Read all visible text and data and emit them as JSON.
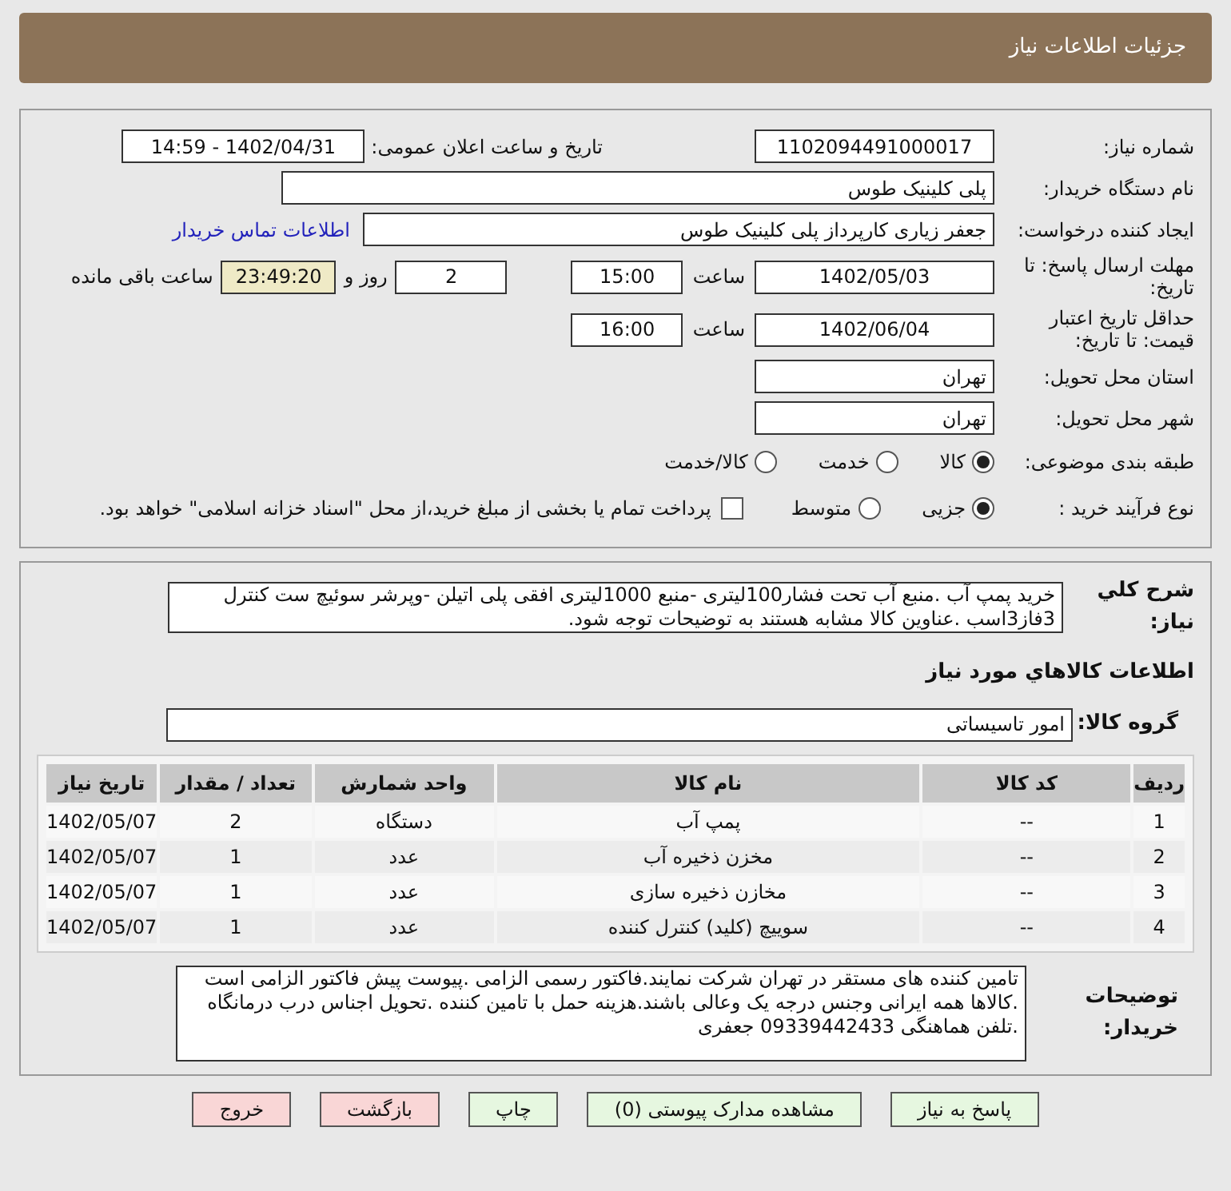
{
  "header": {
    "title": "جزئیات اطلاعات نیاز"
  },
  "need_number": {
    "label": "شماره نیاز:",
    "value": "1102094491000017"
  },
  "announce": {
    "label": "تاریخ و ساعت اعلان عمومی:",
    "value": "1402/04/31 - 14:59"
  },
  "buyer_org": {
    "label": "نام دستگاه خریدار:",
    "value": "پلی کلینیک طوس"
  },
  "requester": {
    "label": "ایجاد کننده درخواست:",
    "value": "جعفر زیاری کارپرداز پلی کلینیک طوس",
    "link": "اطلاعات تماس خریدار"
  },
  "deadline": {
    "label": "مهلت ارسال پاسخ: تا تاریخ:",
    "date": "1402/05/03",
    "time_label": "ساعت",
    "time": "15:00",
    "days": "2",
    "days_label": "روز و",
    "remaining": "23:49:20",
    "remaining_label": "ساعت باقی مانده"
  },
  "validity": {
    "label": "حداقل تاریخ اعتبار قیمت: تا تاریخ:",
    "date": "1402/06/04",
    "time_label": "ساعت",
    "time": "16:00"
  },
  "province": {
    "label": "استان محل تحویل:",
    "value": "تهران"
  },
  "city": {
    "label": "شهر محل تحویل:",
    "value": "تهران"
  },
  "category": {
    "label": "طبقه بندی موضوعی:",
    "options": [
      {
        "label": "کالا",
        "selected": true
      },
      {
        "label": "خدمت",
        "selected": false
      },
      {
        "label": "کالا/خدمت",
        "selected": false
      }
    ]
  },
  "process": {
    "label": "نوع فرآیند خرید :",
    "options": [
      {
        "label": "جزیی",
        "selected": true
      },
      {
        "label": "متوسط",
        "selected": false
      }
    ],
    "payment": {
      "checked": false,
      "label": "پرداخت تمام یا بخشی از مبلغ خرید،از محل \"اسناد خزانه اسلامی\" خواهد بود."
    }
  },
  "description": {
    "label": "شرح کلي نیاز:",
    "value": "خرید پمپ آب .منبع آب تحت فشار100لیتری -منبع 1000لیتری افقی پلی اتیلن -وپرشر سوئیچ ست کنترل 3فاز3اسب .عناوین کالا مشابه هستند به توضیحات توجه شود."
  },
  "goods_heading": "اطلاعات کالاهاي مورد نیاز",
  "goods_group": {
    "label": "گروه کالا:",
    "value": "امور تاسیساتی"
  },
  "table": {
    "columns": [
      "ردیف",
      "کد کالا",
      "نام کالا",
      "واحد شمارش",
      "تعداد / مقدار",
      "تاریخ نیاز"
    ],
    "rows": [
      [
        "1",
        "--",
        "پمپ آب",
        "دستگاه",
        "2",
        "1402/05/07"
      ],
      [
        "2",
        "--",
        "مخزن ذخیره آب",
        "عدد",
        "1",
        "1402/05/07"
      ],
      [
        "3",
        "--",
        "مخازن ذخیره سازی",
        "عدد",
        "1",
        "1402/05/07"
      ],
      [
        "4",
        "--",
        "سوییچ (کلید) کنترل کننده",
        "عدد",
        "1",
        "1402/05/07"
      ]
    ]
  },
  "buyer_notes": {
    "label": "توضیحات خریدار:",
    "value": "تامین کننده های مستقر در تهران شرکت نمایند.فاکتور رسمی الزامی .پیوست پیش فاکتور الزامی است .کالاها همه ایرانی وجنس درجه یک وعالی باشند.هزینه حمل با تامین کننده .تحویل اجناس درب درمانگاه .تلفن هماهنگی 09339442433 جعفری"
  },
  "buttons": [
    {
      "label": "پاسخ به نیاز",
      "kind": "green"
    },
    {
      "label": "مشاهده مدارک پیوستی (0)",
      "kind": "green"
    },
    {
      "label": "چاپ",
      "kind": "green"
    },
    {
      "label": "بازگشت",
      "kind": "red"
    },
    {
      "label": "خروج",
      "kind": "red"
    }
  ]
}
